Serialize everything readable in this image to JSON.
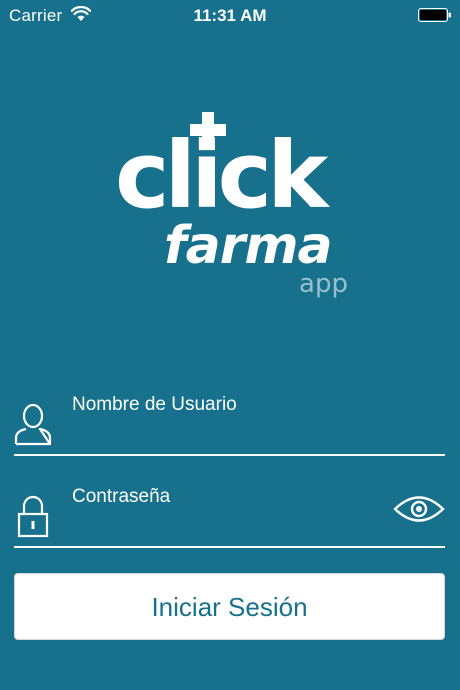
{
  "status_bar": {
    "carrier": "Carrier",
    "time": "11:31 AM",
    "wifi_icon": "wifi-icon",
    "battery_icon": "battery-full-icon"
  },
  "logo": {
    "word_click": "click",
    "word_farma": "farma",
    "word_app": "app",
    "plus_icon": "medical-plus-icon"
  },
  "form": {
    "username": {
      "placeholder": "Nombre de Usuario",
      "value": "",
      "icon": "user-icon"
    },
    "password": {
      "placeholder": "Contraseña",
      "value": "",
      "icon": "lock-icon",
      "toggle_icon": "eye-icon"
    },
    "submit_label": "Iniciar Sesión"
  },
  "colors": {
    "background": "#17718c",
    "foreground": "#ffffff",
    "button_text": "#17718c"
  }
}
